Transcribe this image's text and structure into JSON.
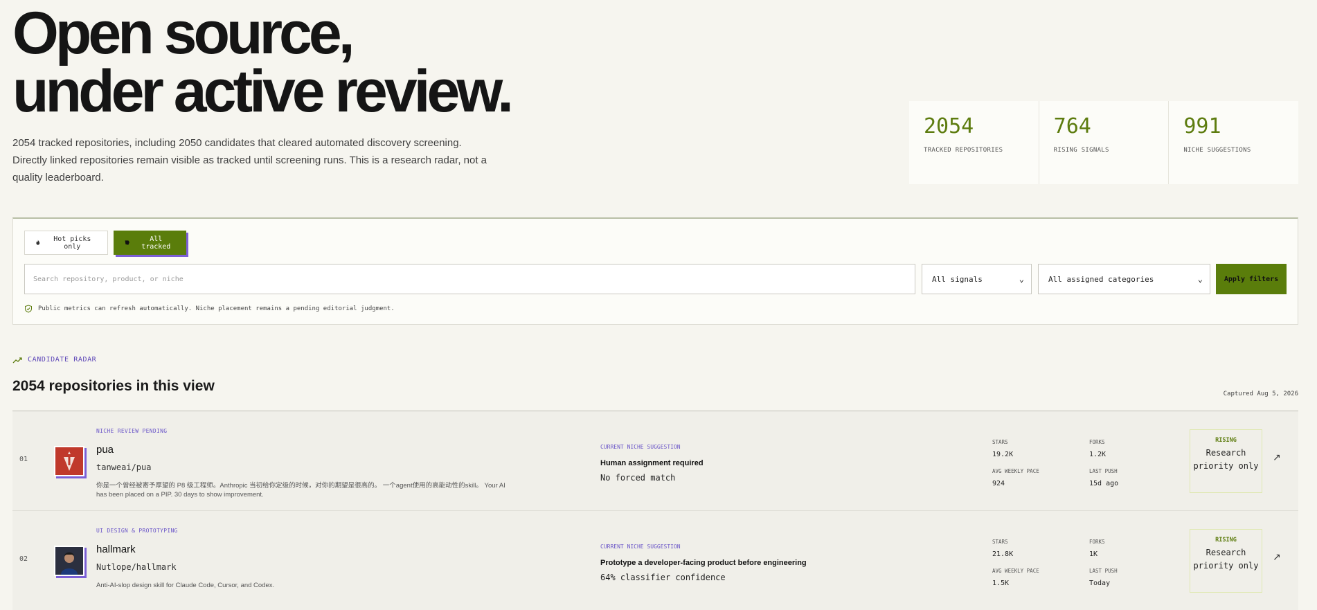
{
  "hero": {
    "title_line1": "Open source,",
    "title_line2": "under active review.",
    "description": "2054 tracked repositories, including 2050 candidates that cleared automated discovery screening. Directly linked repositories remain visible as tracked until screening runs. This is a research radar, not a quality leaderboard."
  },
  "stats": [
    {
      "value": "2054",
      "label": "TRACKED REPOSITORIES"
    },
    {
      "value": "764",
      "label": "RISING SIGNALS"
    },
    {
      "value": "991",
      "label": "NICHE SUGGESTIONS"
    }
  ],
  "filters": {
    "toggle_hot": "Hot picks only",
    "toggle_all": "All tracked",
    "search_placeholder": "Search repository, product, or niche",
    "signals_select": "All signals",
    "categories_select": "All assigned categories",
    "apply": "Apply filters",
    "notice": "Public metrics can refresh automatically. Niche placement remains a pending editorial judgment."
  },
  "radar": {
    "kicker": "CANDIDATE RADAR",
    "title": "2054 repositories in this view",
    "captured": "Captured Aug 5, 2026",
    "metric_labels": {
      "stars": "STARS",
      "forks": "FORKS",
      "pace": "AVG WEEKLY PACE",
      "push": "LAST PUSH"
    },
    "suggestion_label": "CURRENT NICHE SUGGESTION",
    "rows": [
      {
        "rank": "01",
        "tag": "NICHE REVIEW PENDING",
        "name": "pua",
        "path": "tanweai/pua",
        "description": "你是一个曾经被寄予厚望的 P8 级工程师。Anthropic 当初给你定级的时候，对你的期望是很高的。 一个agent使用的高能动性的skill。 Your AI has been placed on a PIP. 30 days to show improvement.",
        "suggestion_title": "Human assignment required",
        "suggestion_detail": "No forced match",
        "stars": "19.2K",
        "forks": "1.2K",
        "pace": "924",
        "push": "15d ago",
        "status_tag": "RISING",
        "status_text": "Research priority only",
        "link_icon": "↗"
      },
      {
        "rank": "02",
        "tag": "UI DESIGN & PROTOTYPING",
        "name": "hallmark",
        "path": "Nutlope/hallmark",
        "description": "Anti-AI-slop design skill for Claude Code, Cursor, and Codex.",
        "suggestion_title": "Prototype a developer-facing product before engineering",
        "suggestion_detail": "64% classifier confidence",
        "stars": "21.8K",
        "forks": "1K",
        "pace": "1.5K",
        "push": "Today",
        "status_tag": "RISING",
        "status_text": "Research priority only",
        "link_icon": "↗"
      }
    ]
  },
  "colors": {
    "accent_green": "#5a7d0b",
    "accent_purple": "#7b5fd6",
    "stat_green": "#5d7c0f"
  }
}
